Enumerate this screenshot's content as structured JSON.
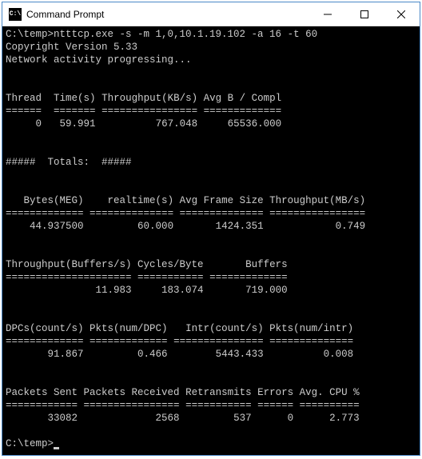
{
  "window": {
    "title": "Command Prompt",
    "icon_label": "C:\\"
  },
  "prompt": {
    "path": "C:\\temp>",
    "command": "ntttcp.exe -s -m 1,0,10.1.19.102 -a 16 -t 60"
  },
  "header": {
    "copyright": "Copyright Version 5.33",
    "activity": "Network activity progressing..."
  },
  "table1": {
    "h1": "Thread",
    "h2": "Time(s)",
    "h3": "Throughput(KB/s)",
    "h4": "Avg B / Compl",
    "sep1": "======",
    "sep2": "=======",
    "sep3": "================",
    "sep4": "=============",
    "r1c1": "     0",
    "r1c2": " 59.991",
    "r1c3": "         767.048",
    "r1c4": "    65536.000"
  },
  "totals_header": "#####  Totals:  #####",
  "table2": {
    "h1": "   Bytes(MEG)",
    "h2": "   realtime(s)",
    "h3": "Avg Frame Size",
    "h4": "Throughput(MB/s)",
    "sep1": "=============",
    "sep2": "==============",
    "sep3": "==============",
    "sep4": "================",
    "r1c1": "    44.937500",
    "r1c2": "        60.000",
    "r1c3": "      1424.351",
    "r1c4": "           0.749"
  },
  "table3": {
    "h1": "Throughput(Buffers/s)",
    "h2": "Cycles/Byte",
    "h3": "      Buffers",
    "sep1": "=====================",
    "sep2": "===========",
    "sep3": "=============",
    "r1c1": "               11.983",
    "r1c2": "    183.074",
    "r1c3": "      719.000"
  },
  "table4": {
    "h1": "DPCs(count/s)",
    "h2": "Pkts(num/DPC)",
    "h3": "  Intr(count/s)",
    "h4": "Pkts(num/intr)",
    "sep1": "=============",
    "sep2": "=============",
    "sep3": "===============",
    "sep4": "==============",
    "r1c1": "       91.867",
    "r1c2": "        0.466",
    "r1c3": "       5443.433",
    "r1c4": "         0.008"
  },
  "table5": {
    "h1": "Packets Sent",
    "h2": "Packets Received",
    "h3": "Retransmits",
    "h4": "Errors",
    "h5": "Avg. CPU %",
    "sep1": "============",
    "sep2": "================",
    "sep3": "===========",
    "sep4": "======",
    "sep5": "==========",
    "r1c1": "       33082",
    "r1c2": "            2568",
    "r1c3": "        537",
    "r1c4": "     0",
    "r1c5": "     2.773"
  },
  "prompt_end": "C:\\temp>"
}
